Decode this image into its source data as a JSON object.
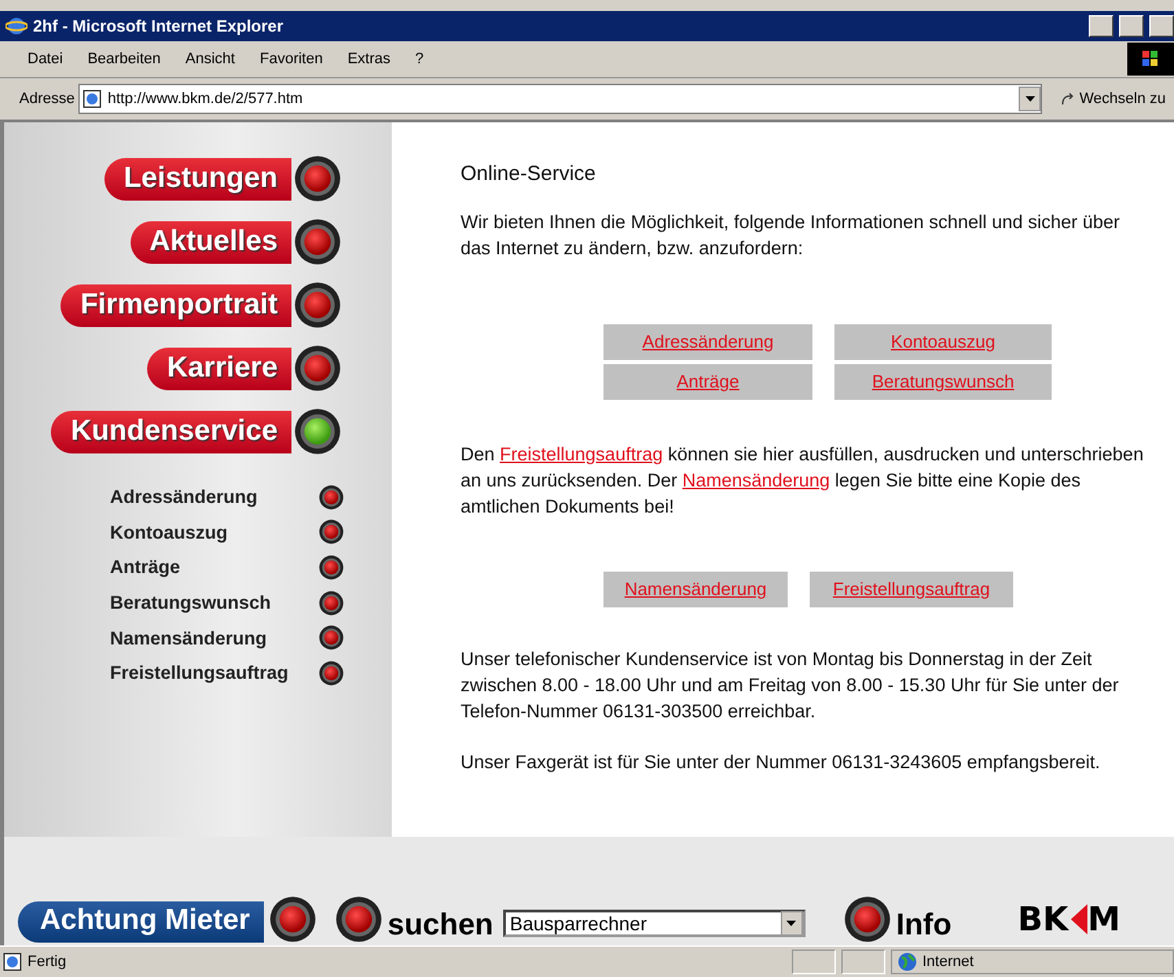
{
  "window": {
    "title": "2hf - Microsoft Internet Explorer"
  },
  "menu": [
    "Datei",
    "Bearbeiten",
    "Ansicht",
    "Favoriten",
    "Extras",
    "?"
  ],
  "address": {
    "label": "Adresse",
    "url": "http://www.bkm.de/2/577.htm",
    "go": "Wechseln zu"
  },
  "nav": [
    {
      "label": "Leistungen",
      "selected": false
    },
    {
      "label": "Aktuelles",
      "selected": false
    },
    {
      "label": "Firmenportrait",
      "selected": false
    },
    {
      "label": "Karriere",
      "selected": false
    },
    {
      "label": "Kundenservice",
      "selected": true
    }
  ],
  "subnav": [
    "Adressänderung",
    "Kontoauszug",
    "Anträge",
    "Beratungswunsch",
    "Namensänderung",
    "Freistellungsauftrag"
  ],
  "content": {
    "heading": "Online-Service",
    "intro": "Wir bieten Ihnen die Möglichkeit, folgende Informationen schnell und sicher über das Internet zu ändern, bzw. anzufordern:",
    "buttons": [
      "Adressänderung",
      "Kontoauszug",
      "Anträge",
      "Beratungswunsch"
    ],
    "paragraph": [
      {
        "kind": "text",
        "text": "Den "
      },
      {
        "kind": "link",
        "text": "Freistellungsauftrag"
      },
      {
        "kind": "text",
        "text": " können sie hier ausfüllen, ausdrucken und unterschrieben an uns zurücksenden. Der "
      },
      {
        "kind": "link",
        "text": "Namensänderung"
      },
      {
        "kind": "text",
        "text": " legen Sie bitte eine Kopie des amtlichen Dokuments bei!"
      }
    ],
    "buttons2": [
      "Namensänderung",
      "Freistellungsauftrag"
    ],
    "phone": "Unser telefonischer Kundenservice ist von Montag bis Donnerstag in der Zeit zwischen 8.00 - 18.00 Uhr und am Freitag von 8.00 - 15.30 Uhr für Sie unter der Telefon-Nummer 06131-303500 erreichbar.",
    "fax": "Unser Faxgerät ist für Sie unter der Nummer 06131-3243605 empfangsbereit."
  },
  "footer": {
    "notice": "Achtung Mieter",
    "search_label": "suchen",
    "search_value": "Bausparrechner",
    "info": "Info",
    "logo_left": "BK",
    "logo_right": "M"
  },
  "status": {
    "text": "Fertig",
    "zone": "Internet"
  }
}
